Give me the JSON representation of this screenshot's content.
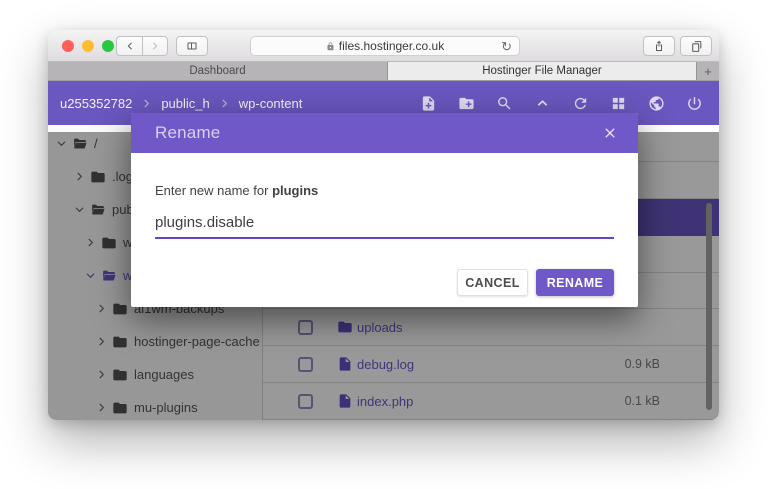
{
  "colors": {
    "accent": "#7158c9",
    "app_header": "#6a57bf",
    "selected_row": "#5f49bd",
    "link": "#5e4fc6",
    "traffic_red": "#ff5f57",
    "traffic_yellow": "#febc2e",
    "traffic_green": "#28c840"
  },
  "browser": {
    "url": "files.hostinger.co.uk",
    "reload_glyph": "↻",
    "tabs": [
      {
        "label": "Dashboard",
        "active": false
      },
      {
        "label": "Hostinger File Manager",
        "active": true
      }
    ],
    "new_tab_label": "+"
  },
  "header": {
    "breadcrumb": [
      "u255352782",
      "public_h",
      "wp-content"
    ],
    "toolbar_icons": [
      "new-file",
      "new-folder",
      "search",
      "upload",
      "refresh",
      "grid",
      "globe",
      "power"
    ]
  },
  "sidebar": {
    "items": [
      {
        "label": "/",
        "level": 0,
        "state": "expanded",
        "icon": "folder-open",
        "selected": false
      },
      {
        "label": ".logs",
        "level": 1,
        "state": "collapsed",
        "icon": "folder",
        "selected": false
      },
      {
        "label": "publ",
        "level": 1,
        "state": "expanded",
        "icon": "folder-open",
        "selected": false
      },
      {
        "label": "wp",
        "level": 2,
        "state": "collapsed",
        "icon": "folder",
        "selected": false
      },
      {
        "label": "wp",
        "level": 2,
        "state": "expanded",
        "icon": "folder-open",
        "selected": true
      },
      {
        "label": "ai1wm-backups",
        "level": 3,
        "state": "collapsed",
        "icon": "folder",
        "selected": false
      },
      {
        "label": "hostinger-page-cache",
        "level": 3,
        "state": "collapsed",
        "icon": "folder",
        "selected": false
      },
      {
        "label": "languages",
        "level": 3,
        "state": "collapsed",
        "icon": "folder",
        "selected": false
      },
      {
        "label": "mu-plugins",
        "level": 3,
        "state": "collapsed",
        "icon": "folder",
        "selected": false
      }
    ]
  },
  "files": {
    "rows": [
      {
        "name": "",
        "type": "",
        "size": "",
        "selected": false
      },
      {
        "name": "",
        "type": "",
        "size": "",
        "selected": false
      },
      {
        "name": "",
        "type": "",
        "size": "",
        "selected": true
      },
      {
        "name": "",
        "type": "",
        "size": "",
        "selected": false
      },
      {
        "name": "",
        "type": "",
        "size": "",
        "selected": false
      },
      {
        "name": "uploads",
        "type": "folder",
        "size": "",
        "selected": false
      },
      {
        "name": "debug.log",
        "type": "file",
        "size": "0.9 kB",
        "selected": false
      },
      {
        "name": "index.php",
        "type": "file",
        "size": "0.1 kB",
        "selected": false
      }
    ]
  },
  "modal": {
    "title": "Rename",
    "label_prefix": "Enter new name for ",
    "target_name": "plugins",
    "input_value": "plugins.disable",
    "cancel_label": "CANCEL",
    "confirm_label": "RENAME"
  }
}
